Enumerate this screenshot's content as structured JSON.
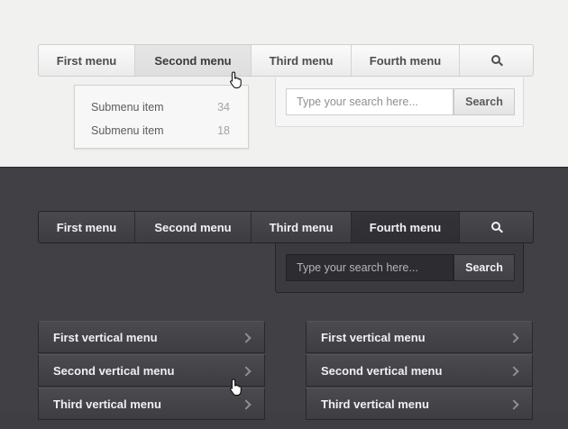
{
  "nav_light": {
    "items": [
      "First menu",
      "Second menu",
      "Third menu",
      "Fourth menu"
    ],
    "active": "Second menu",
    "search_icon": "search-icon"
  },
  "submenu": {
    "items": [
      {
        "label": "Submenu item",
        "count": "34"
      },
      {
        "label": "Submenu item",
        "count": "18"
      }
    ]
  },
  "search_light": {
    "placeholder": "Type your search here...",
    "button": "Search"
  },
  "nav_dark": {
    "items": [
      "First menu",
      "Second menu",
      "Third menu",
      "Fourth menu"
    ],
    "active": "Fourth menu",
    "search_icon": "search-icon"
  },
  "search_dark": {
    "placeholder": "Type your search here...",
    "button": "Search"
  },
  "vmenu_left": [
    "First vertical menu",
    "Second vertical menu",
    "Third vertical menu"
  ],
  "vmenu_right": [
    "First vertical menu",
    "Second vertical menu",
    "Third vertical menu"
  ],
  "colors": {
    "light_bg": "#f1f1f0",
    "dark_bg": "#414045"
  }
}
